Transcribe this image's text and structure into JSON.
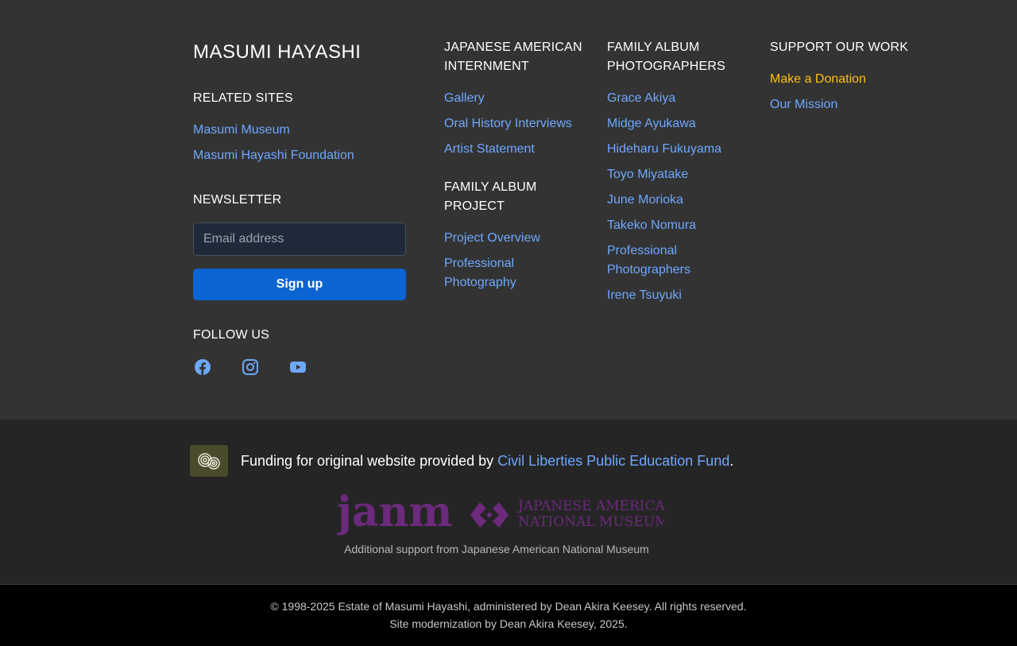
{
  "brand": "MASUMI HAYASHI",
  "related": {
    "heading": "RELATED SITES",
    "links": [
      "Masumi Museum",
      "Masumi Hayashi Foundation"
    ]
  },
  "newsletter": {
    "heading": "NEWSLETTER",
    "placeholder": "Email address",
    "button": "Sign up"
  },
  "follow": {
    "heading": "FOLLOW US",
    "icons": [
      "facebook-icon",
      "instagram-icon",
      "youtube-icon"
    ]
  },
  "internment": {
    "heading_line1": "JAPANESE AMERICAN",
    "heading_line2": "INTERNMENT",
    "links": [
      "Gallery",
      "Oral History Interviews",
      "Artist Statement"
    ]
  },
  "family_project": {
    "heading_line1": "FAMILY ALBUM",
    "heading_line2": "PROJECT",
    "links": [
      "Project Overview",
      "Professional Photography"
    ]
  },
  "photographers": {
    "heading_line1": "FAMILY ALBUM",
    "heading_line2": "PHOTOGRAPHERS",
    "links": [
      "Grace Akiya",
      "Midge Ayukawa",
      "Hideharu Fukuyama",
      "Toyo Miyatake",
      "June Morioka",
      "Takeko Nomura",
      "Professional Photographers",
      "Irene Tsuyuki"
    ]
  },
  "support": {
    "heading": "SUPPORT OUR WORK",
    "links": [
      "Make a Donation",
      "Our Mission"
    ]
  },
  "funding": {
    "prefix": "Funding for original website provided by ",
    "link": "Civil Liberties Public Education Fund",
    "suffix": "."
  },
  "janm": {
    "logo_word": "janm",
    "logo_line1": "JAPANESE AMERICAN",
    "logo_line2": "NATIONAL MUSEUM",
    "caption": "Additional support from Japanese American National Museum"
  },
  "footer": {
    "copyright": "© 1998-2025 Estate of Masumi Hayashi, administered by Dean Akira Keesey. All rights reserved.",
    "modernization": "Site modernization by Dean Akira Keesey, 2025."
  },
  "colors": {
    "link": "#6ea8fe",
    "donate": "#ffc107",
    "signup": "#0b64d1",
    "janm_purple": "#6c2a7c"
  }
}
